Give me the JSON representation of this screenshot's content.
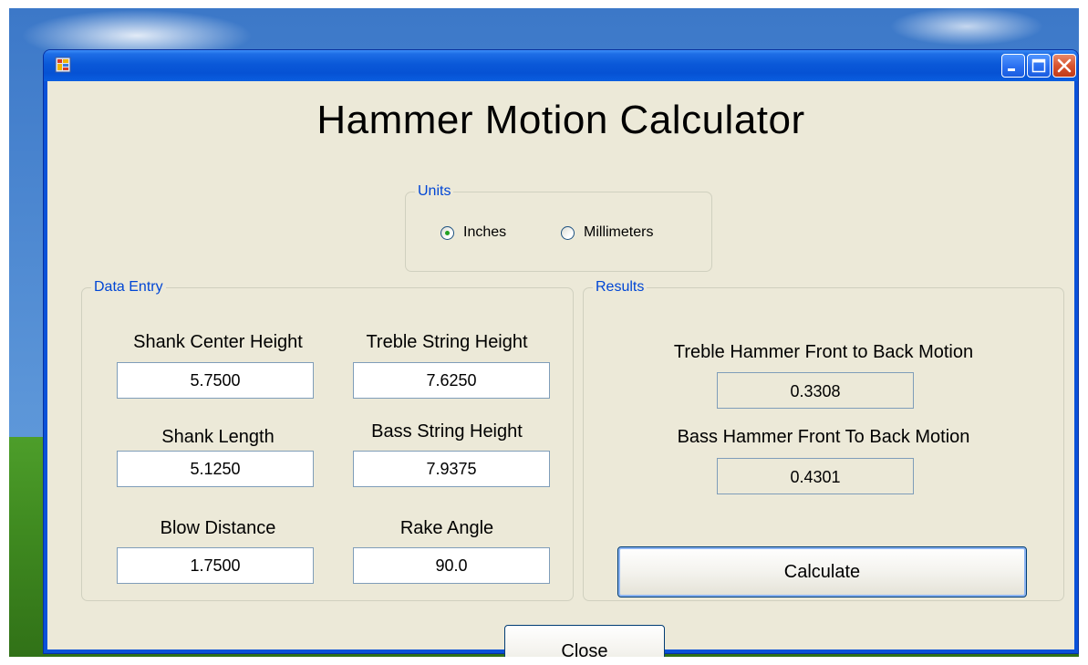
{
  "window": {
    "title": "",
    "app_title": "Hammer Motion Calculator",
    "controls": [
      "minimize",
      "maximize",
      "close"
    ]
  },
  "units": {
    "legend": "Units",
    "options": [
      {
        "label": "Inches",
        "selected": true
      },
      {
        "label": "Millimeters",
        "selected": false
      }
    ]
  },
  "data_entry": {
    "legend": "Data Entry",
    "fields": {
      "shank_center_height": {
        "label": "Shank Center Height",
        "value": "5.7500"
      },
      "treble_string_height": {
        "label": "Treble String Height",
        "value": "7.6250"
      },
      "shank_length": {
        "label": "Shank Length",
        "value": "5.1250"
      },
      "bass_string_height": {
        "label": "Bass String Height",
        "value": "7.9375"
      },
      "blow_distance": {
        "label": "Blow Distance",
        "value": "1.7500"
      },
      "rake_angle": {
        "label": "Rake Angle",
        "value": "90.0"
      }
    }
  },
  "results": {
    "legend": "Results",
    "treble": {
      "label": "Treble Hammer Front to Back Motion",
      "value": "0.3308"
    },
    "bass": {
      "label": "Bass Hammer Front To Back Motion",
      "value": "0.4301"
    },
    "calculate_label": "Calculate"
  },
  "close_label": "Close",
  "colors": {
    "titlebar": "#0a58d8",
    "client_bg": "#ece9d8",
    "group_legend": "#0046d5",
    "radio_selected": "#21a121"
  },
  "icons": {
    "app": "app-icon",
    "minimize": "minimize-icon",
    "maximize": "maximize-icon",
    "close": "close-icon"
  }
}
